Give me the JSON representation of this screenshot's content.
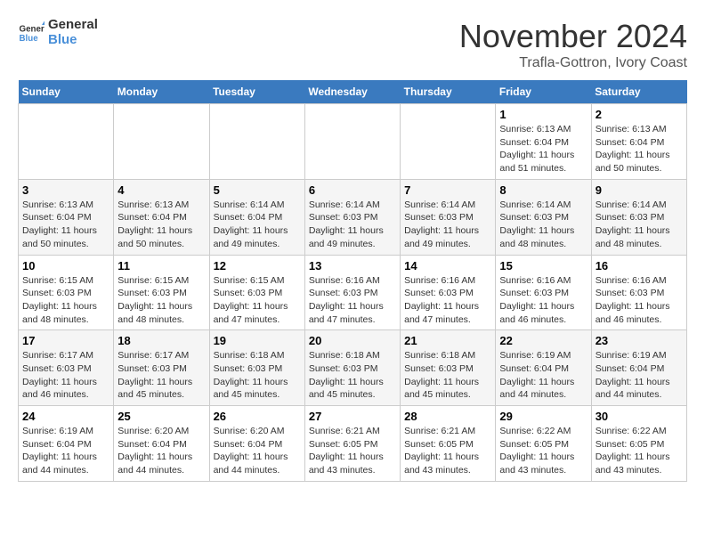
{
  "header": {
    "logo_line1": "General",
    "logo_line2": "Blue",
    "month": "November 2024",
    "location": "Trafla-Gottron, Ivory Coast"
  },
  "weekdays": [
    "Sunday",
    "Monday",
    "Tuesday",
    "Wednesday",
    "Thursday",
    "Friday",
    "Saturday"
  ],
  "weeks": [
    [
      {
        "day": "",
        "info": ""
      },
      {
        "day": "",
        "info": ""
      },
      {
        "day": "",
        "info": ""
      },
      {
        "day": "",
        "info": ""
      },
      {
        "day": "",
        "info": ""
      },
      {
        "day": "1",
        "info": "Sunrise: 6:13 AM\nSunset: 6:04 PM\nDaylight: 11 hours and 51 minutes."
      },
      {
        "day": "2",
        "info": "Sunrise: 6:13 AM\nSunset: 6:04 PM\nDaylight: 11 hours and 50 minutes."
      }
    ],
    [
      {
        "day": "3",
        "info": "Sunrise: 6:13 AM\nSunset: 6:04 PM\nDaylight: 11 hours and 50 minutes."
      },
      {
        "day": "4",
        "info": "Sunrise: 6:13 AM\nSunset: 6:04 PM\nDaylight: 11 hours and 50 minutes."
      },
      {
        "day": "5",
        "info": "Sunrise: 6:14 AM\nSunset: 6:04 PM\nDaylight: 11 hours and 49 minutes."
      },
      {
        "day": "6",
        "info": "Sunrise: 6:14 AM\nSunset: 6:03 PM\nDaylight: 11 hours and 49 minutes."
      },
      {
        "day": "7",
        "info": "Sunrise: 6:14 AM\nSunset: 6:03 PM\nDaylight: 11 hours and 49 minutes."
      },
      {
        "day": "8",
        "info": "Sunrise: 6:14 AM\nSunset: 6:03 PM\nDaylight: 11 hours and 48 minutes."
      },
      {
        "day": "9",
        "info": "Sunrise: 6:14 AM\nSunset: 6:03 PM\nDaylight: 11 hours and 48 minutes."
      }
    ],
    [
      {
        "day": "10",
        "info": "Sunrise: 6:15 AM\nSunset: 6:03 PM\nDaylight: 11 hours and 48 minutes."
      },
      {
        "day": "11",
        "info": "Sunrise: 6:15 AM\nSunset: 6:03 PM\nDaylight: 11 hours and 48 minutes."
      },
      {
        "day": "12",
        "info": "Sunrise: 6:15 AM\nSunset: 6:03 PM\nDaylight: 11 hours and 47 minutes."
      },
      {
        "day": "13",
        "info": "Sunrise: 6:16 AM\nSunset: 6:03 PM\nDaylight: 11 hours and 47 minutes."
      },
      {
        "day": "14",
        "info": "Sunrise: 6:16 AM\nSunset: 6:03 PM\nDaylight: 11 hours and 47 minutes."
      },
      {
        "day": "15",
        "info": "Sunrise: 6:16 AM\nSunset: 6:03 PM\nDaylight: 11 hours and 46 minutes."
      },
      {
        "day": "16",
        "info": "Sunrise: 6:16 AM\nSunset: 6:03 PM\nDaylight: 11 hours and 46 minutes."
      }
    ],
    [
      {
        "day": "17",
        "info": "Sunrise: 6:17 AM\nSunset: 6:03 PM\nDaylight: 11 hours and 46 minutes."
      },
      {
        "day": "18",
        "info": "Sunrise: 6:17 AM\nSunset: 6:03 PM\nDaylight: 11 hours and 45 minutes."
      },
      {
        "day": "19",
        "info": "Sunrise: 6:18 AM\nSunset: 6:03 PM\nDaylight: 11 hours and 45 minutes."
      },
      {
        "day": "20",
        "info": "Sunrise: 6:18 AM\nSunset: 6:03 PM\nDaylight: 11 hours and 45 minutes."
      },
      {
        "day": "21",
        "info": "Sunrise: 6:18 AM\nSunset: 6:03 PM\nDaylight: 11 hours and 45 minutes."
      },
      {
        "day": "22",
        "info": "Sunrise: 6:19 AM\nSunset: 6:04 PM\nDaylight: 11 hours and 44 minutes."
      },
      {
        "day": "23",
        "info": "Sunrise: 6:19 AM\nSunset: 6:04 PM\nDaylight: 11 hours and 44 minutes."
      }
    ],
    [
      {
        "day": "24",
        "info": "Sunrise: 6:19 AM\nSunset: 6:04 PM\nDaylight: 11 hours and 44 minutes."
      },
      {
        "day": "25",
        "info": "Sunrise: 6:20 AM\nSunset: 6:04 PM\nDaylight: 11 hours and 44 minutes."
      },
      {
        "day": "26",
        "info": "Sunrise: 6:20 AM\nSunset: 6:04 PM\nDaylight: 11 hours and 44 minutes."
      },
      {
        "day": "27",
        "info": "Sunrise: 6:21 AM\nSunset: 6:05 PM\nDaylight: 11 hours and 43 minutes."
      },
      {
        "day": "28",
        "info": "Sunrise: 6:21 AM\nSunset: 6:05 PM\nDaylight: 11 hours and 43 minutes."
      },
      {
        "day": "29",
        "info": "Sunrise: 6:22 AM\nSunset: 6:05 PM\nDaylight: 11 hours and 43 minutes."
      },
      {
        "day": "30",
        "info": "Sunrise: 6:22 AM\nSunset: 6:05 PM\nDaylight: 11 hours and 43 minutes."
      }
    ]
  ]
}
